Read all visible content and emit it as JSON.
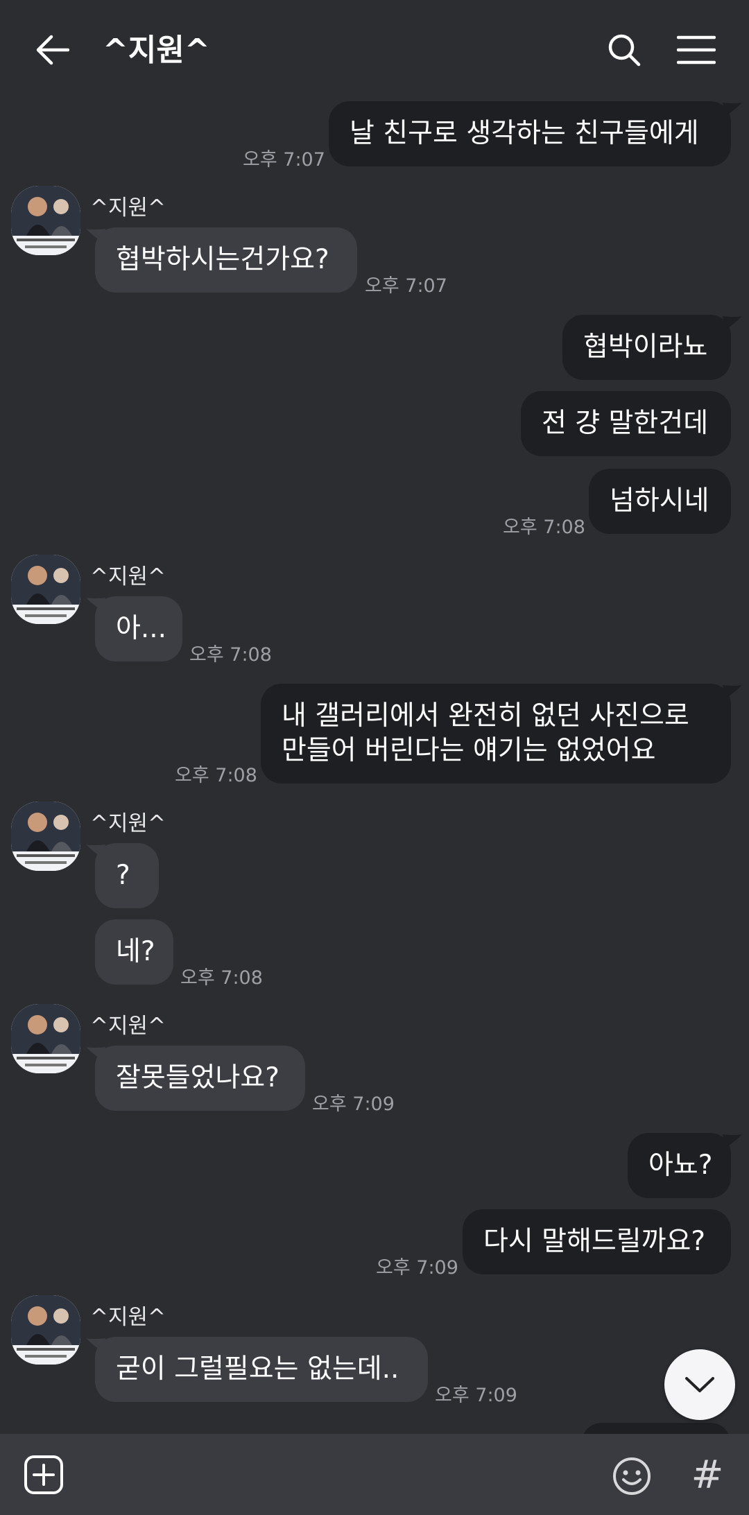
{
  "header": {
    "title": "^지원^",
    "back_icon": "arrow-left-icon",
    "search_icon": "search-icon",
    "menu_icon": "hamburger-menu-icon"
  },
  "chat": {
    "sender_name": "^지원^",
    "messages": [
      {
        "from": "me",
        "text": "날 친구로 생각하는 친구들에게",
        "time": "오후 7:07"
      },
      {
        "from": "other",
        "text": "협박하시는건가요?",
        "time": "오후 7:07"
      },
      {
        "from": "me",
        "text": "협박이라뇨",
        "time": ""
      },
      {
        "from": "me",
        "text": "전 걍 말한건데",
        "time": ""
      },
      {
        "from": "me",
        "text": "넘하시네",
        "time": "오후 7:08"
      },
      {
        "from": "other",
        "text": "아...",
        "time": "오후 7:08"
      },
      {
        "from": "me",
        "text": "내 갤러리에서 완전히 없던 사진으로 만들어 버린다는 얘기는 없었어요",
        "time": "오후 7:08"
      },
      {
        "from": "other",
        "text": "?",
        "time": ""
      },
      {
        "from": "other",
        "text": "네?",
        "time": "오후 7:08"
      },
      {
        "from": "other",
        "text": "잘못들었나요?",
        "time": "오후 7:09"
      },
      {
        "from": "me",
        "text": "아뇨?",
        "time": ""
      },
      {
        "from": "me",
        "text": "다시 말해드릴까요?",
        "time": "오후 7:09"
      },
      {
        "from": "other",
        "text": "굳이 그럴필요는 없는데..",
        "time": "오후 7:09"
      }
    ]
  },
  "scroll_down_icon": "chevron-down-icon",
  "bottom_bar": {
    "plus_icon": "plus-box-icon",
    "emoji_icon": "emoji-smile-icon",
    "hash_label": "#"
  },
  "colors": {
    "background": "#2b2d31",
    "my_bubble": "#1e1f22",
    "other_bubble": "#3c3e44",
    "bottom_bar": "#393b41",
    "timestamp": "#9ea0a5"
  }
}
